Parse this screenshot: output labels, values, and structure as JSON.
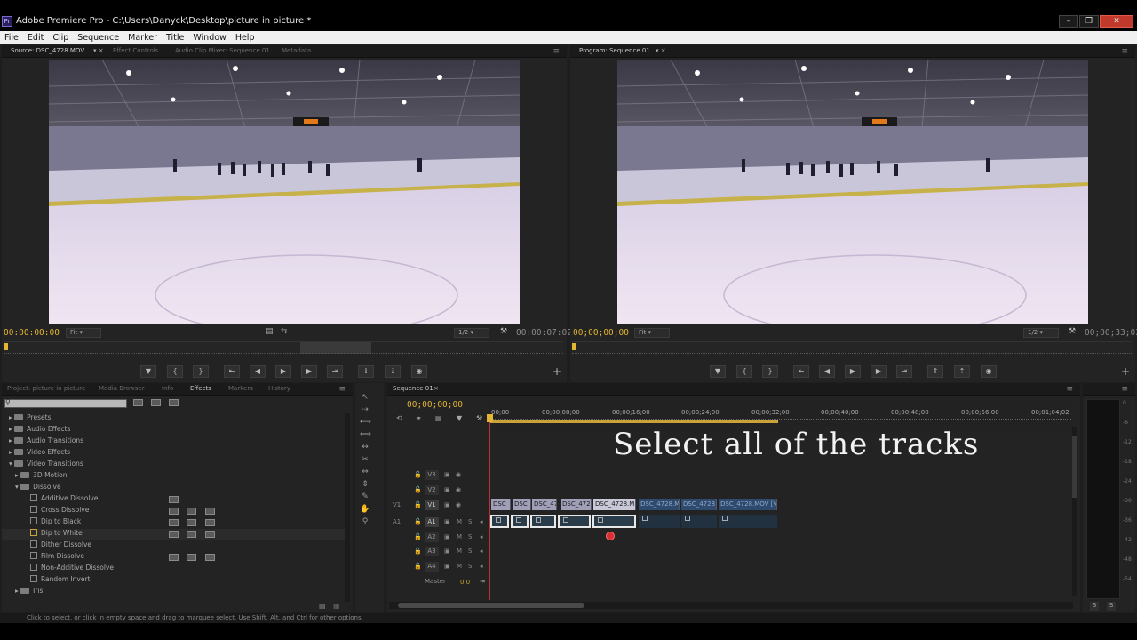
{
  "app": {
    "window_title": "Adobe Premiere Pro - C:\\Users\\Danyck\\Desktop\\picture in picture *",
    "icon_label": "Pr"
  },
  "menu": [
    "File",
    "Edit",
    "Clip",
    "Sequence",
    "Marker",
    "Title",
    "Window",
    "Help"
  ],
  "source_monitor": {
    "tabs": [
      "Source: DSC_4728.MOV",
      "Effect Controls",
      "Audio Clip Mixer: Sequence 01",
      "Metadata"
    ],
    "timecode_in": "00:00:00:00",
    "timecode_out": "00:00:07:02",
    "fit": "Fit",
    "resolution": "1/2"
  },
  "program_monitor": {
    "tab": "Program: Sequence 01",
    "timecode_in": "00;00;00;00",
    "timecode_out": "00;00;33;02",
    "fit": "Fit",
    "resolution": "1/2"
  },
  "project_panel": {
    "tabs": [
      "Project: picture in picture",
      "Media Browser",
      "Info",
      "Effects",
      "Markers",
      "History"
    ],
    "search_placeholder": "",
    "tree": [
      {
        "label": "Presets",
        "indent": 0
      },
      {
        "label": "Audio Effects",
        "indent": 0
      },
      {
        "label": "Audio Transitions",
        "indent": 0
      },
      {
        "label": "Video Effects",
        "indent": 0
      },
      {
        "label": "Video Transitions",
        "indent": 0
      },
      {
        "label": "3D Motion",
        "indent": 1
      },
      {
        "label": "Dissolve",
        "indent": 1
      },
      {
        "label": "Additive Dissolve",
        "indent": 2
      },
      {
        "label": "Cross Dissolve",
        "indent": 2
      },
      {
        "label": "Dip to Black",
        "indent": 2
      },
      {
        "label": "Dip to White",
        "indent": 2
      },
      {
        "label": "Dither Dissolve",
        "indent": 2
      },
      {
        "label": "Film Dissolve",
        "indent": 2
      },
      {
        "label": "Non-Additive Dissolve",
        "indent": 2
      },
      {
        "label": "Random Invert",
        "indent": 2
      },
      {
        "label": "Iris",
        "indent": 1
      }
    ]
  },
  "timeline": {
    "tab": "Sequence 01",
    "timecode": "00;00;00;00",
    "ruler": [
      "00;00",
      "00;00;08;00",
      "00;00;16;00",
      "00;00;24;00",
      "00;00;32;00",
      "00;00;40;00",
      "00;00;48;00",
      "00;00;56;00",
      "00;01;04;02"
    ],
    "tracks_video": [
      "V3",
      "V2",
      "V1"
    ],
    "tracks_audio": [
      "A1",
      "A2",
      "A3",
      "A4"
    ],
    "source_v": "V1",
    "source_a": "A1",
    "master_label": "Master",
    "master_value": "0,0",
    "clips_v": [
      "DSC",
      "DSC",
      "DSC_47",
      "DSC_472",
      "DSC_4728.M",
      "DSC_4728.M",
      "DSC_4728",
      "DSC_4728.MOV [V"
    ],
    "overlay_text": "Select all of the tracks"
  },
  "meter": {
    "labels": [
      "0",
      "-6",
      "-12",
      "-18",
      "-24",
      "-30",
      "-36",
      "-42",
      "-48",
      "-54"
    ],
    "solo_labels": [
      "S",
      "S"
    ]
  },
  "status": "Click to select, or click in empty space and drag to marquee select. Use Shift, Alt, and Ctrl for other options."
}
